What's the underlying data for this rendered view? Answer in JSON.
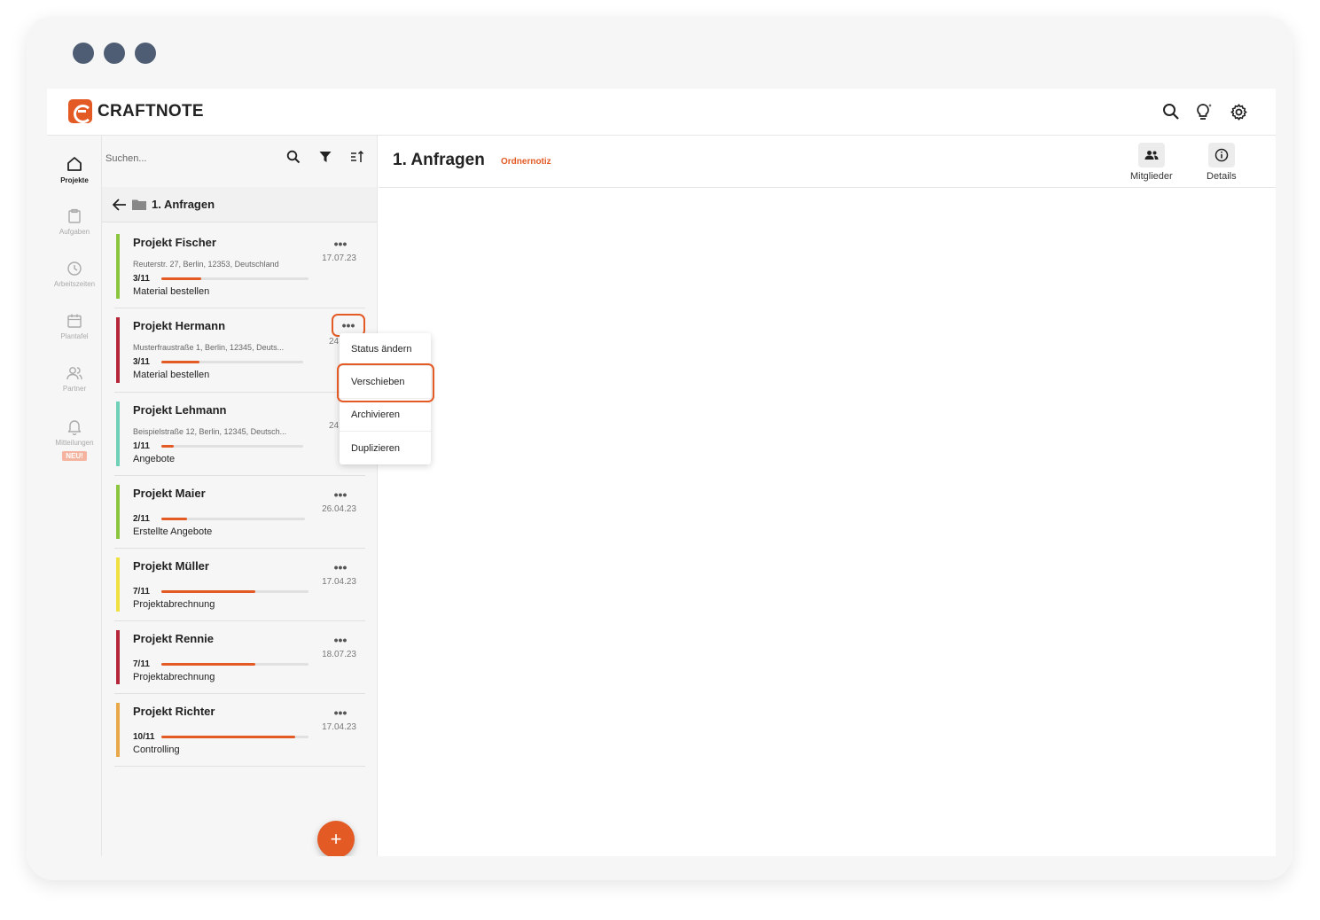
{
  "app": {
    "name": "CRAFTNOTE"
  },
  "colors": {
    "accent": "#e35a25",
    "window_dots": "#4e5d73"
  },
  "topbar": {
    "icons": [
      "search-icon",
      "lightbulb-icon",
      "gear-icon"
    ]
  },
  "nav": {
    "items": [
      {
        "label": "Projekte",
        "icon": "home-icon",
        "active": true
      },
      {
        "label": "Aufgaben",
        "icon": "clipboard-icon"
      },
      {
        "label": "Arbeitszeiten",
        "icon": "clock-icon"
      },
      {
        "label": "Plantafel",
        "icon": "calendar-icon"
      },
      {
        "label": "Partner",
        "icon": "people-icon"
      },
      {
        "label": "Mitteilungen",
        "icon": "bell-icon",
        "badge": "NEU!"
      }
    ]
  },
  "list": {
    "search_placeholder": "Suchen...",
    "folder": "1. Anfragen",
    "projects": [
      {
        "title": "Projekt Fischer",
        "date": "17.07.23",
        "address": "Reuterstr. 27, Berlin, 12353, Deutschland",
        "count": "3/11",
        "progress": 0.27,
        "status": "Material bestellen",
        "color": "#8cc63f"
      },
      {
        "title": "Projekt Hermann",
        "date": "24.04",
        "address": "Musterfraustraße 1, Berlin, 12345, Deuts...",
        "count": "3/11",
        "progress": 0.27,
        "status": "Material bestellen",
        "color": "#b5263b"
      },
      {
        "title": "Projekt Lehmann",
        "date": "24.04",
        "address": "Beispielstraße 12, Berlin, 12345, Deutsch...",
        "count": "1/11",
        "progress": 0.09,
        "status": "Angebote",
        "color": "#6fd0b8"
      },
      {
        "title": "Projekt Maier",
        "date": "26.04.23",
        "address": "",
        "count": "2/11",
        "progress": 0.18,
        "status": "Erstellte Angebote",
        "color": "#8cc63f"
      },
      {
        "title": "Projekt Müller",
        "date": "17.04.23",
        "address": "",
        "count": "7/11",
        "progress": 0.64,
        "status": "Projektabrechnung",
        "color": "#f0e040"
      },
      {
        "title": "Projekt Rennie",
        "date": "18.07.23",
        "address": "",
        "count": "7/11",
        "progress": 0.64,
        "status": "Projektabrechnung",
        "color": "#b5263b"
      },
      {
        "title": "Projekt Richter",
        "date": "17.04.23",
        "address": "",
        "count": "10/11",
        "progress": 0.91,
        "status": "Controlling",
        "color": "#e8a84a"
      }
    ],
    "fab": "+"
  },
  "main": {
    "title": "1. Anfragen",
    "note": "Ordnernotiz",
    "buttons": [
      {
        "label": "Mitglieder",
        "icon": "members-icon"
      },
      {
        "label": "Details",
        "icon": "info-icon"
      }
    ]
  },
  "context_menu": {
    "items": [
      "Status ändern",
      "Verschieben",
      "Archivieren",
      "Duplizieren"
    ],
    "highlighted": "Verschieben"
  }
}
